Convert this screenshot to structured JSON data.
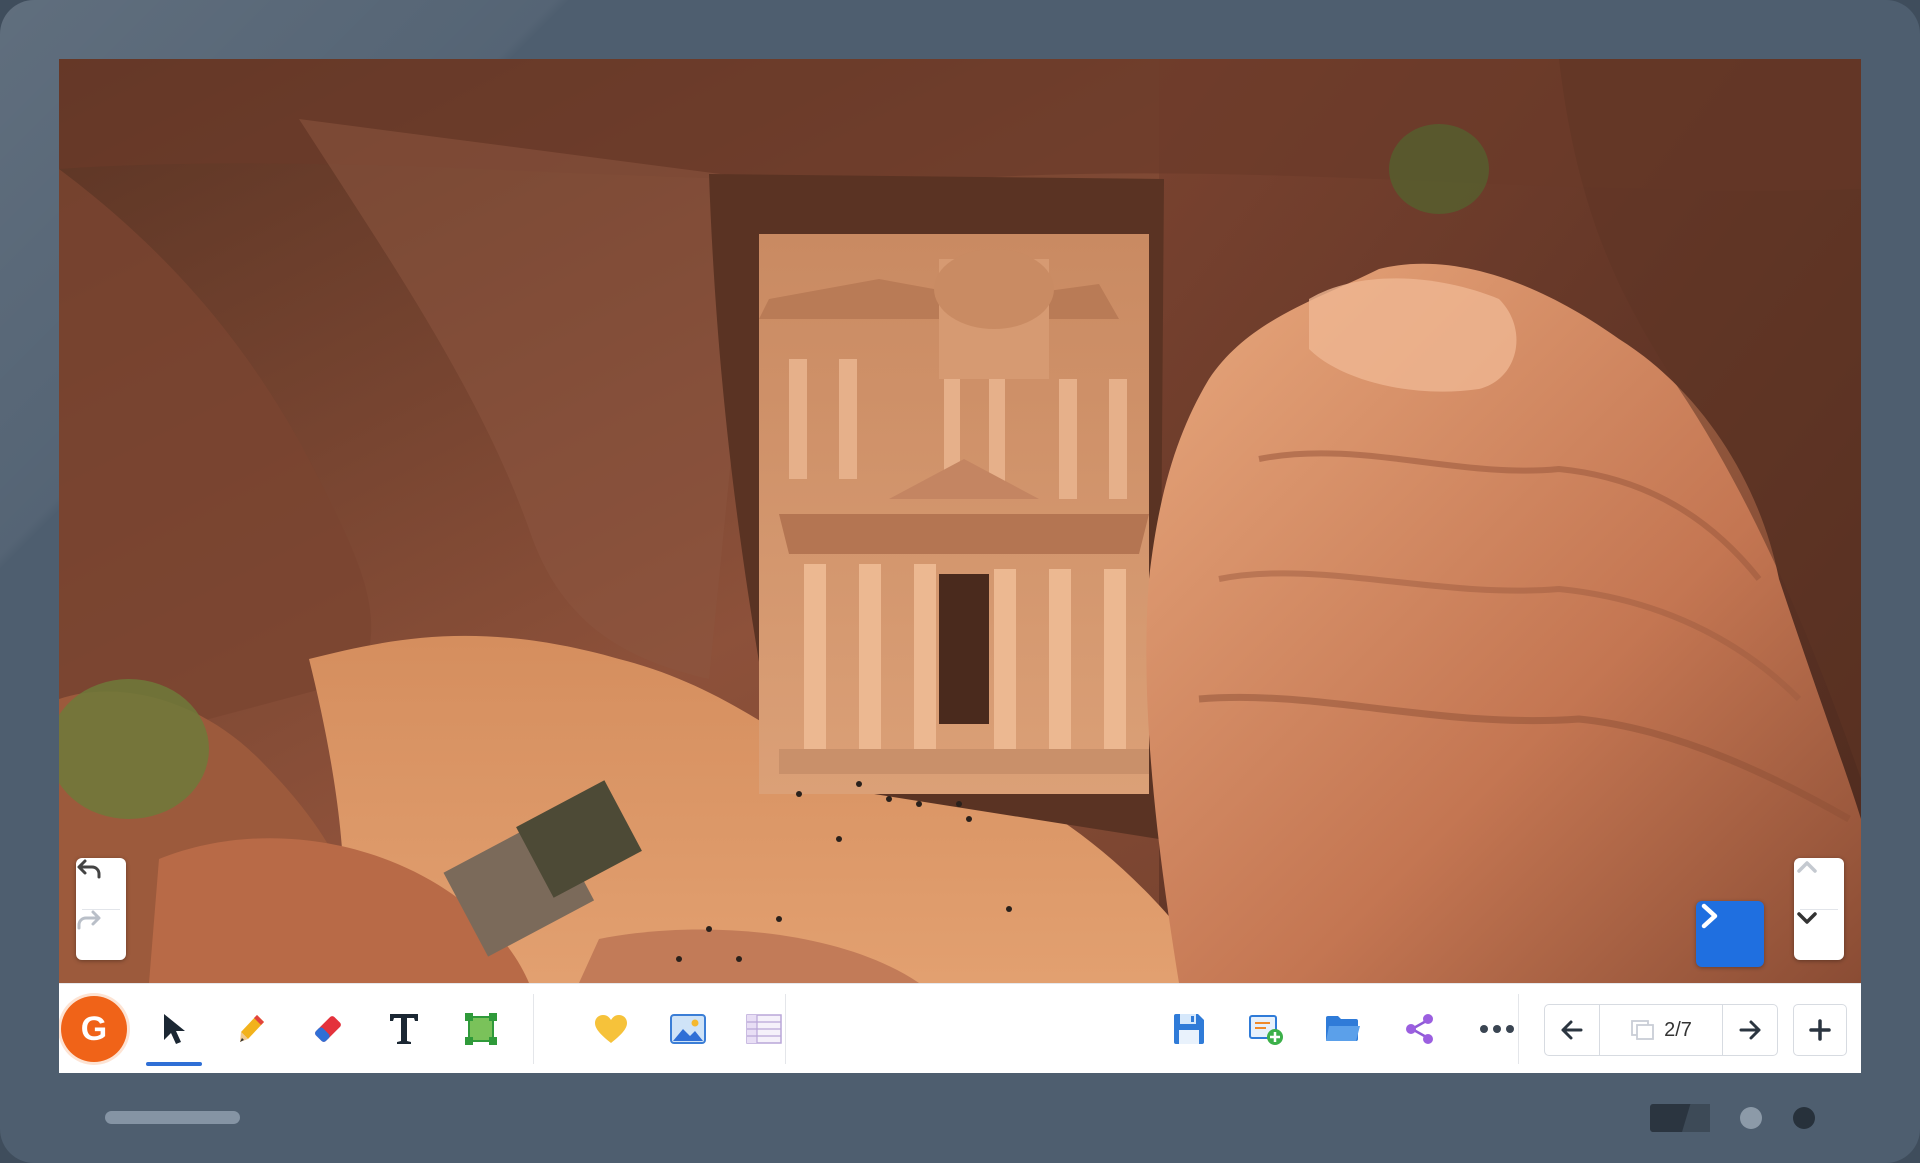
{
  "board": {
    "canvas_image": "petra-treasury-canyon-photo"
  },
  "overlay": {
    "undo_icon": "undo-icon",
    "redo_icon": "redo-icon",
    "next_icon": "chevron-right-icon",
    "scroll_up_icon": "chevron-up-icon",
    "scroll_down_icon": "chevron-down-icon"
  },
  "toolbar": {
    "logo_letter": "G",
    "tools": [
      {
        "name": "select",
        "icon": "cursor-arrow-icon",
        "active": true
      },
      {
        "name": "pen",
        "icon": "pencil-icon"
      },
      {
        "name": "eraser",
        "icon": "eraser-icon"
      },
      {
        "name": "text",
        "icon": "text-icon",
        "glyph": "T"
      },
      {
        "name": "shape",
        "icon": "square-shape-icon"
      }
    ],
    "insert": [
      {
        "name": "sticker",
        "icon": "heart-icon"
      },
      {
        "name": "image",
        "icon": "image-icon"
      },
      {
        "name": "table",
        "icon": "table-icon"
      }
    ],
    "actions": [
      {
        "name": "save",
        "icon": "save-icon"
      },
      {
        "name": "new-board",
        "icon": "new-board-icon"
      },
      {
        "name": "open",
        "icon": "folder-icon"
      },
      {
        "name": "share",
        "icon": "share-icon"
      },
      {
        "name": "more",
        "icon": "more-icon"
      }
    ],
    "pager": {
      "prev_icon": "arrow-left-icon",
      "pages_icon": "pages-icon",
      "current": "2/7",
      "next_icon": "arrow-right-icon"
    },
    "add_page_icon": "plus-icon"
  },
  "colors": {
    "accent": "#1f6fe0",
    "logo": "#f06318",
    "bezel": "#4e5e6f"
  }
}
